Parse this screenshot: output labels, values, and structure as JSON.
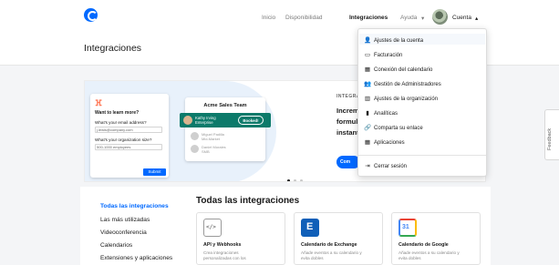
{
  "nav": {
    "items": [
      "Inicio",
      "Disponibilidad",
      "Integraciones",
      "Ayuda"
    ],
    "help_caret": "▾",
    "account": "Cuenta",
    "account_caret": "▴"
  },
  "page": {
    "title": "Integraciones"
  },
  "hero": {
    "form": {
      "heading": "Want to learn more?",
      "email_label": "What's your email address?",
      "email_value": "j.lewis@company.com",
      "org_label": "What's your organization size?",
      "org_value": "500-1000 employees",
      "submit": "Submit"
    },
    "team": {
      "title": "Acme Sales Team",
      "active_name": "Kathy Irving",
      "active_sub": "Enterprise",
      "booked": "Booked!",
      "members": [
        {
          "name": "Miguel Padilla",
          "sub": "Mid-Market"
        },
        {
          "name": "Daniel Morales",
          "sub": "SMB"
        }
      ]
    },
    "kicker": "INTEGRA",
    "lines": [
      "Increm",
      "formula",
      "instant"
    ],
    "button": "Com",
    "carousel_dots": 3,
    "carousel_active": 0
  },
  "sidebar": {
    "items": [
      "Todas las integraciones",
      "Las más utilizadas",
      "Videoconferencia",
      "Calendarios",
      "Extensiones y aplicaciones"
    ],
    "active": 0
  },
  "section": {
    "title": "Todas las integraciones",
    "tiles": [
      {
        "name": "API y Webhooks",
        "desc": "Crea integraciones personalizadas con los",
        "icon": "code-icon"
      },
      {
        "name": "Calendario de Exchange",
        "desc": "Añade eventos a su calendario y evita dobles",
        "icon": "exchange-icon"
      },
      {
        "name": "Calendario de Google",
        "desc": "Añade eventos a su calendario y evita dobles",
        "icon": "google-calendar-icon"
      }
    ]
  },
  "feedback": "Feedback",
  "menu": {
    "items": [
      {
        "label": "Ajustes de la cuenta",
        "icon": "👤"
      },
      {
        "label": "Facturación",
        "icon": "▭"
      },
      {
        "label": "Conexión del calendario",
        "icon": "▦"
      },
      {
        "label": "Gestión de Administradores",
        "icon": "👥"
      },
      {
        "label": "Ajustes de la organización",
        "icon": "▥"
      },
      {
        "label": "Analíticas",
        "icon": "▮"
      },
      {
        "label": "Comparta su enlace",
        "icon": "🔗"
      },
      {
        "label": "Aplicaciones",
        "icon": "▦"
      }
    ],
    "logout": {
      "label": "Cerrar sesión",
      "icon": "⇥"
    }
  },
  "colors": {
    "brand": "#0069ff",
    "teal": "#0c7a6a",
    "hubspot": "#ff7a59"
  }
}
